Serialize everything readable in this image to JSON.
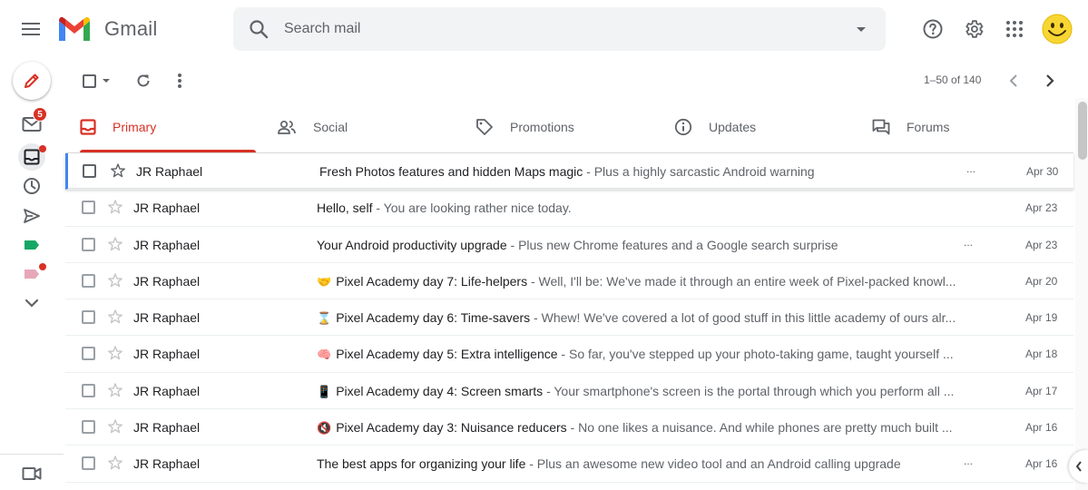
{
  "app": {
    "name": "Gmail"
  },
  "search": {
    "placeholder": "Search mail"
  },
  "rail": {
    "inbox_badge": "5"
  },
  "toolbar": {
    "range": "1–50 of 140"
  },
  "tabs": [
    {
      "label": "Primary",
      "icon": "inbox-icon",
      "active": true
    },
    {
      "label": "Social",
      "icon": "people-icon",
      "active": false
    },
    {
      "label": "Promotions",
      "icon": "tag-icon",
      "active": false
    },
    {
      "label": "Updates",
      "icon": "info-icon",
      "active": false
    },
    {
      "label": "Forums",
      "icon": "forum-icon",
      "active": false
    }
  ],
  "emails": [
    {
      "sender": "JR Raphael",
      "emoji": "",
      "subject": "Fresh Photos features and hidden Maps magic",
      "snippet": " - Plus a highly sarcastic Android warning",
      "ellipsis": "...",
      "date": "Apr 30"
    },
    {
      "sender": "JR Raphael",
      "emoji": "",
      "subject": "Hello, self",
      "snippet": " - You are looking rather nice today.",
      "ellipsis": "",
      "date": "Apr 23"
    },
    {
      "sender": "JR Raphael",
      "emoji": "",
      "subject": "Your Android productivity upgrade",
      "snippet": " - Plus new Chrome features and a Google search surprise",
      "ellipsis": "...",
      "date": "Apr 23"
    },
    {
      "sender": "JR Raphael",
      "emoji": "🤝",
      "subject": "Pixel Academy day 7: Life-helpers",
      "snippet": " - Well, I'll be: We've made it through an entire week of Pixel-packed knowl...",
      "ellipsis": "",
      "date": "Apr 20"
    },
    {
      "sender": "JR Raphael",
      "emoji": "⌛",
      "subject": "Pixel Academy day 6: Time-savers",
      "snippet": " - Whew! We've covered a lot of good stuff in this little academy of ours alr...",
      "ellipsis": "",
      "date": "Apr 19"
    },
    {
      "sender": "JR Raphael",
      "emoji": "🧠",
      "subject": "Pixel Academy day 5: Extra intelligence",
      "snippet": " - So far, you've stepped up your photo-taking game, taught yourself ...",
      "ellipsis": "",
      "date": "Apr 18"
    },
    {
      "sender": "JR Raphael",
      "emoji": "📱",
      "subject": "Pixel Academy day 4: Screen smarts",
      "snippet": " - Your smartphone's screen is the portal through which you perform all ...",
      "ellipsis": "",
      "date": "Apr 17"
    },
    {
      "sender": "JR Raphael",
      "emoji": "🔇",
      "subject": "Pixel Academy day 3: Nuisance reducers",
      "snippet": " - No one likes a nuisance. And while phones are pretty much built ...",
      "ellipsis": "",
      "date": "Apr 16"
    },
    {
      "sender": "JR Raphael",
      "emoji": "",
      "subject": "The best apps for organizing your life",
      "snippet": " - Plus an awesome new video tool and an Android calling upgrade",
      "ellipsis": "...",
      "date": "Apr 16"
    }
  ],
  "colors": {
    "accent": "#d93025",
    "label_green": "#16a765",
    "label_pink": "#e6a8b8",
    "selected_border": "#4285f4"
  }
}
